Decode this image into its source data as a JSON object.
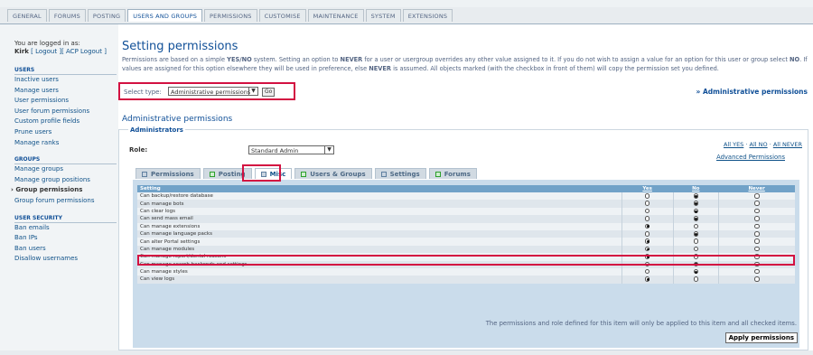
{
  "tabs": [
    "GENERAL",
    "FORUMS",
    "POSTING",
    "USERS AND GROUPS",
    "PERMISSIONS",
    "CUSTOMISE",
    "MAINTENANCE",
    "SYSTEM",
    "EXTENSIONS"
  ],
  "active_tab": "USERS AND GROUPS",
  "login": {
    "prefix": "You are logged in as:",
    "user": "Kirk",
    "logout": "[ Logout ]",
    "acp_logout": "[ ACP Logout ]"
  },
  "sidebar": {
    "sections": [
      {
        "heading": "USERS",
        "items": [
          "Inactive users",
          "Manage users",
          "User permissions",
          "User forum permissions",
          "Custom profile fields",
          "Prune users",
          "Manage ranks"
        ]
      },
      {
        "heading": "GROUPS",
        "items": [
          "Manage groups",
          "Manage group positions",
          "Group permissions",
          "Group forum permissions"
        ]
      },
      {
        "heading": "USER SECURITY",
        "items": [
          "Ban emails",
          "Ban IPs",
          "Ban users",
          "Disallow usernames"
        ]
      }
    ],
    "active_item": "Group permissions"
  },
  "page": {
    "title": "Setting permissions",
    "desc_1": "Permissions are based on a simple ",
    "desc_yesno": "YES/NO",
    "desc_2": " system. Setting an option to ",
    "desc_never": "NEVER",
    "desc_3": " for a user or usergroup overrides any other value assigned to it. If you do not wish to assign a value for an option for this user or group select ",
    "desc_no": "NO",
    "desc_4": ". If values are assigned for this option elsewhere they will be used in preference, else ",
    "desc_never2": "NEVER",
    "desc_5": " is assumed. All objects marked (with the checkbox in front of them) will copy the permission set you defined."
  },
  "select_type": {
    "label": "Select type:",
    "value": "Administrative permissions",
    "go": "Go"
  },
  "right_link": "» Administrative permissions",
  "section_title": "Administrative permissions",
  "legend": "Administrators",
  "role": {
    "label": "Role:",
    "value": "Standard Admin"
  },
  "all_links": {
    "yes": "All YES",
    "sep1": " · ",
    "no": "All NO",
    "sep2": " · ",
    "never": "All NEVER",
    "advanced": "Advanced Permissions"
  },
  "perm_tabs": [
    {
      "label": "Permissions",
      "color": "blue"
    },
    {
      "label": "Posting",
      "color": "green"
    },
    {
      "label": "Misc",
      "color": "blue",
      "active": true
    },
    {
      "label": "Users & Groups",
      "color": "green"
    },
    {
      "label": "Settings",
      "color": "blue"
    },
    {
      "label": "Forums",
      "color": "green"
    }
  ],
  "table": {
    "headers": [
      "Setting",
      "Yes",
      "No",
      "Never"
    ],
    "rows": [
      {
        "setting": "Can backup/restore database",
        "value": "no"
      },
      {
        "setting": "Can manage bots",
        "value": "no"
      },
      {
        "setting": "Can clear logs",
        "value": "no"
      },
      {
        "setting": "Can send mass email",
        "value": "no"
      },
      {
        "setting": "Can manage extensions",
        "value": "yes"
      },
      {
        "setting": "Can manage language packs",
        "value": "no"
      },
      {
        "setting": "Can alter Portal settings",
        "value": "yes"
      },
      {
        "setting": "Can manage modules",
        "value": "yes"
      },
      {
        "setting": "Can manage report/denial reasons",
        "value": "yes"
      },
      {
        "setting": "Can manage search backends and settings",
        "value": "no"
      },
      {
        "setting": "Can manage styles",
        "value": "no"
      },
      {
        "setting": "Can view logs",
        "value": "yes"
      }
    ]
  },
  "note": "The permissions and role defined for this item will only be applied to this item and all checked items.",
  "apply": "Apply permissions"
}
